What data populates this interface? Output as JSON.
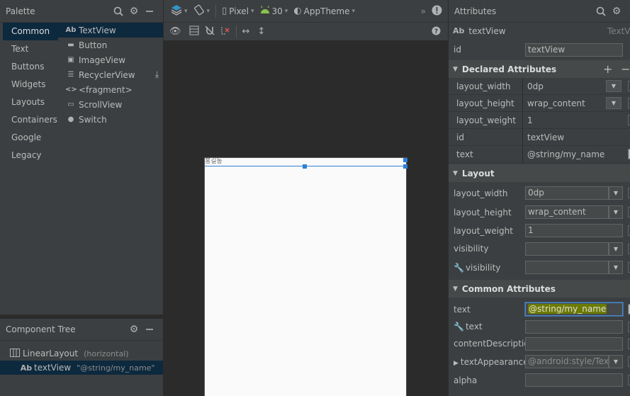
{
  "palette": {
    "title": "Palette",
    "categories": [
      "Common",
      "Text",
      "Buttons",
      "Widgets",
      "Layouts",
      "Containers",
      "Google",
      "Legacy"
    ],
    "items": [
      {
        "icon": "Ab",
        "label": "TextView"
      },
      {
        "icon": "▬",
        "label": "Button"
      },
      {
        "icon": "▣",
        "label": "ImageView"
      },
      {
        "icon": "☰",
        "label": "RecyclerView"
      },
      {
        "icon": "<>",
        "label": "<fragment>"
      },
      {
        "icon": "▭",
        "label": "ScrollView"
      },
      {
        "icon": "●",
        "label": "Switch"
      }
    ]
  },
  "component_tree": {
    "title": "Component Tree",
    "rows": [
      {
        "label": "LinearLayout",
        "meta": "(horizontal)"
      },
      {
        "label": "textView",
        "meta": "\"@string/my_name\""
      }
    ]
  },
  "toolbar": {
    "device": "Pixel",
    "api": "30",
    "theme": "AppTheme",
    "more": "»"
  },
  "canvas": {
    "textview_text": "홍길동"
  },
  "attributes": {
    "title": "Attributes",
    "widget_type": "Ab",
    "widget_name": "textView",
    "widget_class": "TextView",
    "id_label": "id",
    "id_value": "textView",
    "declared_title": "Declared Attributes",
    "declared": [
      {
        "name": "layout_width",
        "value": "0dp"
      },
      {
        "name": "layout_height",
        "value": "wrap_content"
      },
      {
        "name": "layout_weight",
        "value": "1"
      },
      {
        "name": "id",
        "value": "textView"
      },
      {
        "name": "text",
        "value": "@string/my_name"
      }
    ],
    "layout_title": "Layout",
    "layout": [
      {
        "name": "layout_width",
        "value": "0dp"
      },
      {
        "name": "layout_height",
        "value": "wrap_content"
      },
      {
        "name": "layout_weight",
        "value": "1"
      },
      {
        "name": "visibility",
        "value": ""
      },
      {
        "name": "visibility",
        "value": ""
      }
    ],
    "common_title": "Common Attributes",
    "common": [
      {
        "name": "text",
        "value": "@string/my_name"
      },
      {
        "name": "text",
        "value": ""
      },
      {
        "name": "contentDescription",
        "value": ""
      },
      {
        "name": "textAppearance",
        "value": "@android:style/Tex"
      },
      {
        "name": "alpha",
        "value": ""
      }
    ]
  }
}
